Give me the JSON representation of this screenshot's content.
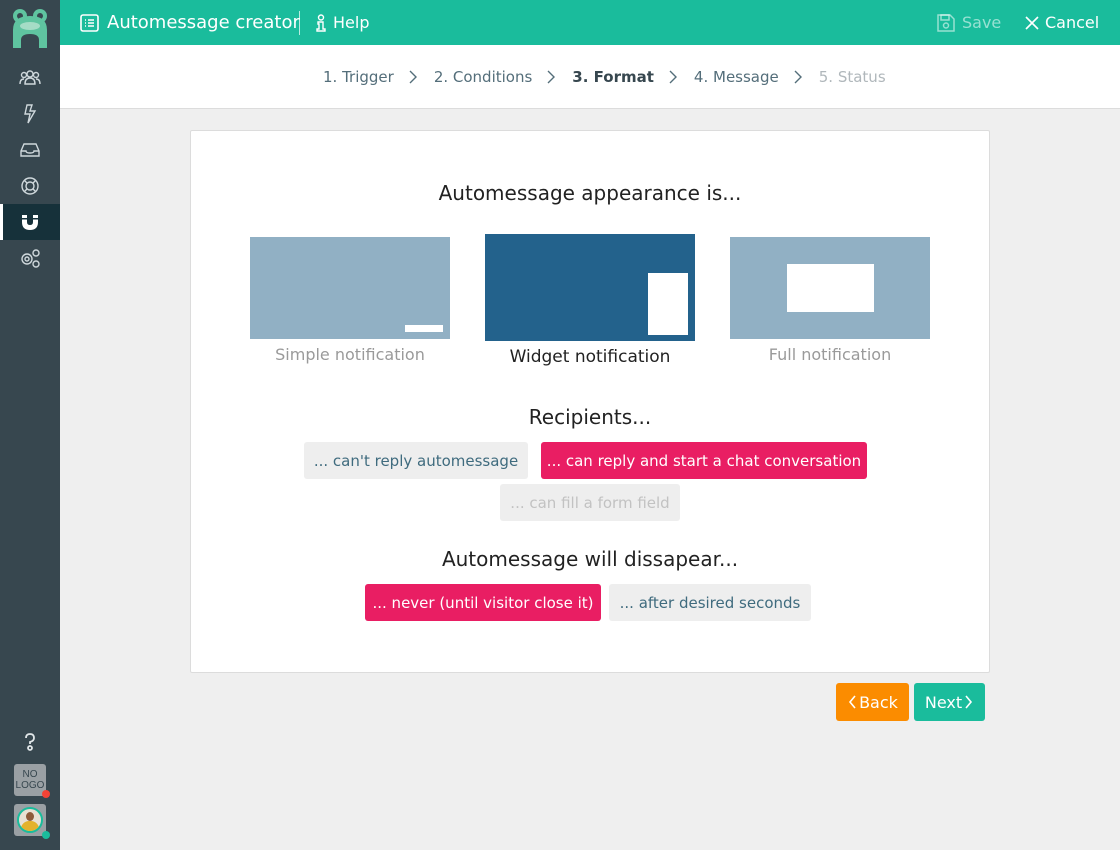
{
  "app": {
    "title": "Automessage creator",
    "help_label": "Help",
    "save_label": "Save",
    "cancel_label": "Cancel"
  },
  "sidebar": {
    "items": [
      {
        "icon": "users-icon"
      },
      {
        "icon": "lightning-icon"
      },
      {
        "icon": "inbox-icon"
      },
      {
        "icon": "lifebuoy-icon"
      },
      {
        "icon": "magnet-icon",
        "active": true
      },
      {
        "icon": "settings-gears-icon"
      }
    ],
    "help_icon": "question-icon",
    "no_logo_text_1": "NO",
    "no_logo_text_2": "LOGO"
  },
  "steps": [
    {
      "label": "1. Trigger",
      "state": "done"
    },
    {
      "label": "2. Conditions",
      "state": "done"
    },
    {
      "label": "3. Format",
      "state": "current"
    },
    {
      "label": "4. Message",
      "state": "done"
    },
    {
      "label": "5. Status",
      "state": "disabled"
    }
  ],
  "format": {
    "appearance_heading": "Automessage appearance is...",
    "appearance_options": [
      {
        "label": "Simple notification",
        "selected": false
      },
      {
        "label": "Widget notification",
        "selected": true
      },
      {
        "label": "Full notification",
        "selected": false
      }
    ],
    "recipients_heading": "Recipients...",
    "recipients_options": [
      {
        "label": "... can't reply automessage",
        "selected": false,
        "disabled": false
      },
      {
        "label": "... can reply and start a chat conversation",
        "selected": true,
        "disabled": false
      },
      {
        "label": "... can fill a form field",
        "selected": false,
        "disabled": true
      }
    ],
    "disappear_heading": "Automessage will dissapear...",
    "disappear_options": [
      {
        "label": "... never (until visitor close it)",
        "selected": true
      },
      {
        "label": "... after desired seconds",
        "selected": false
      }
    ]
  },
  "footer": {
    "back_label": "Back",
    "next_label": "Next"
  },
  "colors": {
    "brand": "#1abc9c",
    "selected_option": "#e91e63",
    "back": "#fb8c00",
    "sidebar": "#37474f"
  }
}
